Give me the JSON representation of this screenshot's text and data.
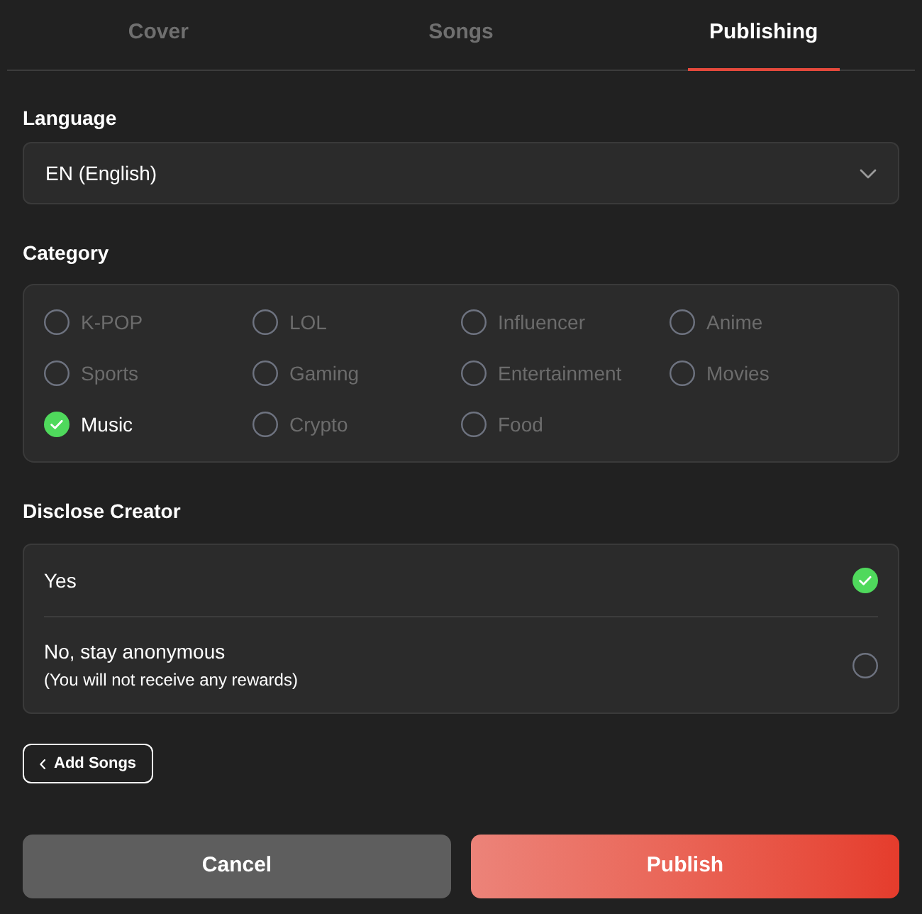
{
  "tabs": [
    {
      "label": "Cover",
      "selected": false
    },
    {
      "label": "Songs",
      "selected": false
    },
    {
      "label": "Publishing",
      "selected": true
    }
  ],
  "language": {
    "label": "Language",
    "value": "EN (English)"
  },
  "category": {
    "label": "Category",
    "options": [
      {
        "label": "K-POP",
        "selected": false
      },
      {
        "label": "LOL",
        "selected": false
      },
      {
        "label": "Influencer",
        "selected": false
      },
      {
        "label": "Anime",
        "selected": false
      },
      {
        "label": "Sports",
        "selected": false
      },
      {
        "label": "Gaming",
        "selected": false
      },
      {
        "label": "Entertainment",
        "selected": false
      },
      {
        "label": "Movies",
        "selected": false
      },
      {
        "label": "Music",
        "selected": true
      },
      {
        "label": "Crypto",
        "selected": false
      },
      {
        "label": "Food",
        "selected": false
      }
    ]
  },
  "disclose_creator": {
    "label": "Disclose Creator",
    "options": [
      {
        "label": "Yes",
        "selected": true
      },
      {
        "label": "No, stay anonymous",
        "note": "(You will not receive any rewards)",
        "selected": false
      }
    ]
  },
  "back_button": {
    "label": "Add Songs"
  },
  "buttons": [
    {
      "label": "Cancel",
      "kind": "secondary"
    },
    {
      "label": "Publish",
      "kind": "primary"
    }
  ]
}
